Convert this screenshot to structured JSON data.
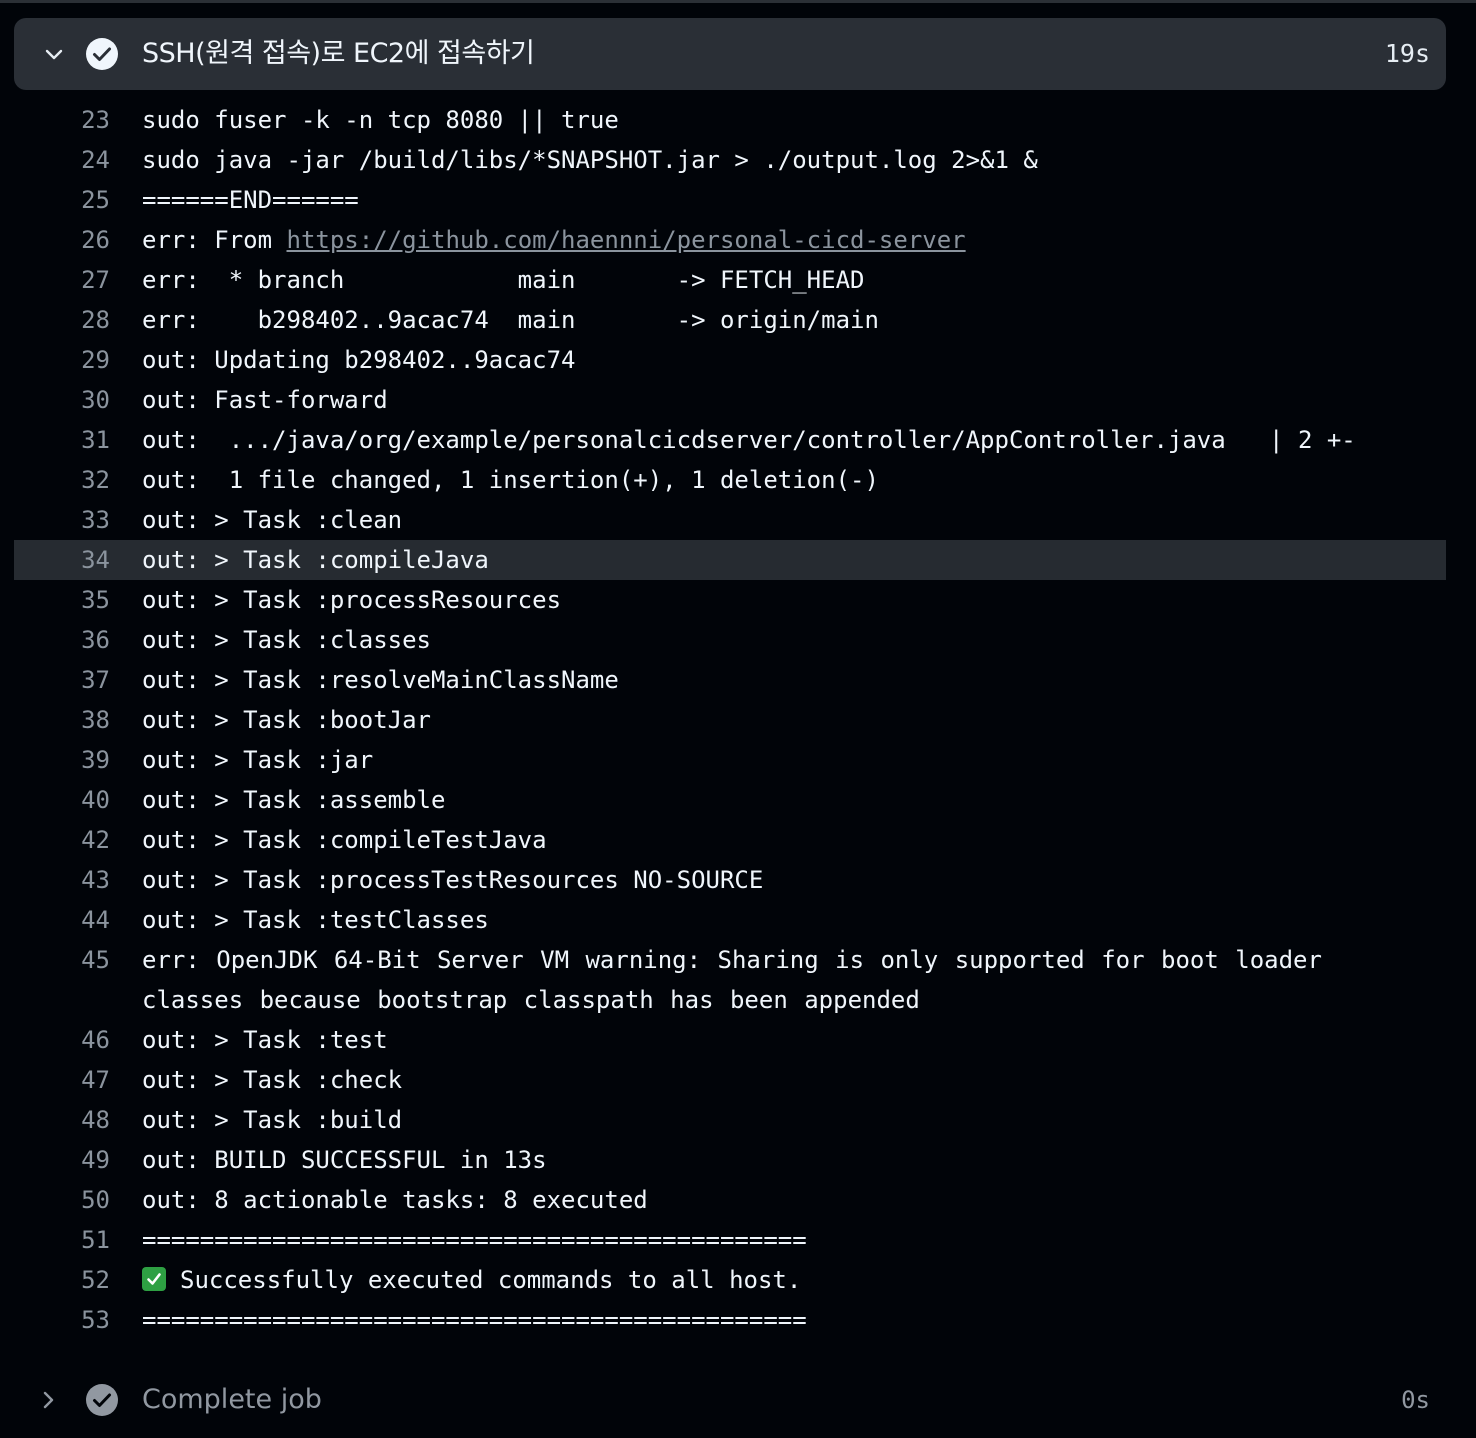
{
  "current_step": {
    "title": "SSH(원격 접속)로 EC2에 접속하기",
    "duration": "19s",
    "status": "success",
    "expanded": true
  },
  "log_lines": [
    {
      "num": "23",
      "text": "sudo fuser -k -n tcp 8080 || true"
    },
    {
      "num": "24",
      "text": "sudo java -jar /build/libs/*SNAPSHOT.jar > ./output.log 2>&1 &"
    },
    {
      "num": "25",
      "text": "======END======"
    },
    {
      "num": "26",
      "prefix": "err: From ",
      "link": "https://github.com/haennni/personal-cicd-server"
    },
    {
      "num": "27",
      "text": "err:  * branch            main       -> FETCH_HEAD"
    },
    {
      "num": "28",
      "text": "err:    b298402..9acac74  main       -> origin/main"
    },
    {
      "num": "29",
      "text": "out: Updating b298402..9acac74"
    },
    {
      "num": "30",
      "text": "out: Fast-forward"
    },
    {
      "num": "31",
      "text": "out:  .../java/org/example/personalcicdserver/controller/AppController.java   | 2 +-"
    },
    {
      "num": "32",
      "text": "out:  1 file changed, 1 insertion(+), 1 deletion(-)"
    },
    {
      "num": "33",
      "text": "out: > Task :clean"
    },
    {
      "num": "34",
      "text": "out: > Task :compileJava",
      "highlighted": true
    },
    {
      "num": "35",
      "text": "out: > Task :processResources"
    },
    {
      "num": "36",
      "text": "out: > Task :classes"
    },
    {
      "num": "37",
      "text": "out: > Task :resolveMainClassName"
    },
    {
      "num": "38",
      "text": "out: > Task :bootJar"
    },
    {
      "num": "39",
      "text": "out: > Task :jar"
    },
    {
      "num": "40",
      "text": "out: > Task :assemble"
    },
    {
      "num": "42",
      "text": "out: > Task :compileTestJava"
    },
    {
      "num": "43",
      "text": "out: > Task :processTestResources NO-SOURCE"
    },
    {
      "num": "44",
      "text": "out: > Task :testClasses"
    },
    {
      "num": "45",
      "text": "err: OpenJDK 64-Bit Server VM warning: Sharing is only supported for boot loader classes because bootstrap classpath has been appended"
    },
    {
      "num": "46",
      "text": "out: > Task :test"
    },
    {
      "num": "47",
      "text": "out: > Task :check"
    },
    {
      "num": "48",
      "text": "out: > Task :build"
    },
    {
      "num": "49",
      "text": "out: BUILD SUCCESSFUL in 13s"
    },
    {
      "num": "50",
      "text": "out: 8 actionable tasks: 8 executed"
    },
    {
      "num": "51",
      "text": "=============================================="
    },
    {
      "num": "52",
      "text": "Successfully executed commands to all host.",
      "icon": "check-mark-emoji-icon"
    },
    {
      "num": "53",
      "text": "=============================================="
    }
  ],
  "next_step": {
    "title": "Complete job",
    "duration": "0s",
    "status": "success",
    "expanded": false
  },
  "colors": {
    "background": "#010409",
    "header_bg": "#2a2f36",
    "highlight_bg": "#262b31",
    "line_number": "#8b949e",
    "text": "#f0f6fc",
    "muted": "#9198a1",
    "success_green": "#2ea043"
  }
}
